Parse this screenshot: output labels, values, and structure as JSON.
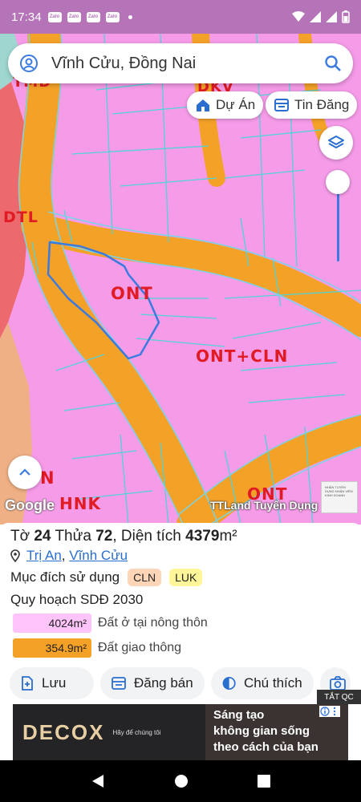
{
  "status_bar": {
    "time": "17:34",
    "notif_icons": [
      "Zalo",
      "Zalo",
      "Zalo",
      "Zalo"
    ]
  },
  "search": {
    "query": "Vĩnh Cửu, Đồng Nai"
  },
  "chips": {
    "projects": "Dự Án",
    "listings": "Tin Đăng"
  },
  "map": {
    "labels": {
      "ont_main": "ONT",
      "ont_cln": "ONT+CLN",
      "dtl": "DTL",
      "ont_bottom": "ONT",
      "hnk": "HNK",
      "top_partial": "TMD",
      "top_partial2": "DKV",
      "left_partial": "N"
    },
    "google": "Google",
    "ttland": "TTLand Tuyển Dụng",
    "thumb_text": "NHẬN TUYỂN DỤNG NHÂN VIÊN KINH DOANH"
  },
  "parcel": {
    "to_label": "Tờ",
    "to_value": "24",
    "thua_label": "Thửa",
    "thua_value": "72",
    "area_label": ", Diện tích",
    "area_value": "4379",
    "area_unit": "m²",
    "ward": "Trị An",
    "district": "Vĩnh Cửu",
    "purpose_label": "Mục đích sử dụng",
    "tags": [
      "CLN",
      "LUK"
    ],
    "plan_label": "Quy hoạch SDĐ 2030",
    "legend": [
      {
        "value": "4024m²",
        "label": "Đất ở tại nông thôn",
        "color": "#ffc4f9"
      },
      {
        "value": "354.9m²",
        "label": "Đất giao thông",
        "color": "#f4a128"
      }
    ]
  },
  "actions": {
    "save": "Lưu",
    "sell": "Đăng bán",
    "legend": "Chú thích"
  },
  "ad": {
    "close_label": "TẮT QC",
    "brand": "DECOX",
    "small": "Hãy để chúng tôi",
    "line1": "Sáng tạo",
    "line2": "không gian sống",
    "line3": "theo cách của bạn"
  },
  "colors": {
    "zone_pink": "#f59be8",
    "road_orange": "#f4a128",
    "accent_blue": "#3b7be0",
    "label_red": "#e11b24"
  }
}
